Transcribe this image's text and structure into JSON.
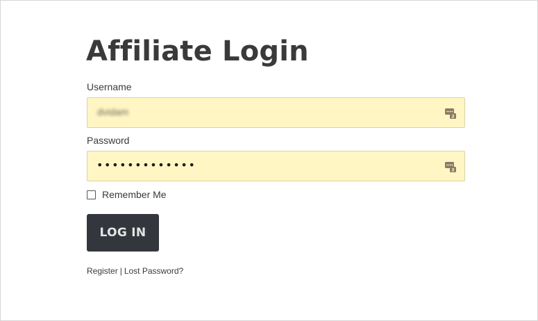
{
  "page": {
    "title": "Affiliate Login"
  },
  "form": {
    "username_label": "Username",
    "username_value": "dvidam",
    "password_label": "Password",
    "password_masked": "•••••••••••••",
    "remember_label": "Remember Me",
    "remember_checked": false,
    "login_button_label": "LOG IN"
  },
  "links": {
    "register": "Register",
    "separator": "|",
    "lost_password": "Lost Password?"
  },
  "icons": {
    "autofill": "password-manager-autofill-icon"
  },
  "colors": {
    "input_background": "#fff6c4",
    "button_background": "#33373d",
    "text": "#3a3a3a"
  }
}
